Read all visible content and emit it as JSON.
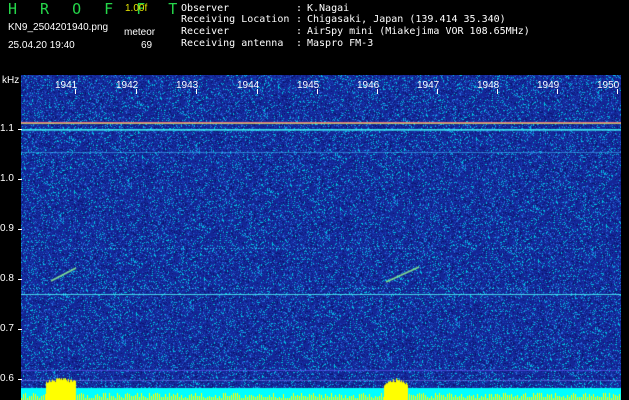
{
  "header": {
    "app_title": "H R O F F T",
    "version": "1.00f",
    "filename": "KN9_2504201940.png",
    "meteor_label": "meteor",
    "datetime": "25.04.20 19:40",
    "meteor_count": "69",
    "info": [
      {
        "key": "Observer",
        "sep": ":",
        "value": "K.Nagai"
      },
      {
        "key": "Receiving Location",
        "sep": ":",
        "value": "Chigasaki, Japan (139.414 35.340)"
      },
      {
        "key": "Receiver",
        "sep": ":",
        "value": "AirSpy mini (Miakejima VOR 108.65MHz)"
      },
      {
        "key": "Receiving antenna",
        "sep": ":",
        "value": "Maspro FM-3"
      }
    ]
  },
  "axis": {
    "unit": "kHz",
    "y_ticks": [
      "1.1",
      "1.0",
      "0.9",
      "0.8",
      "0.7",
      "0.6"
    ],
    "x_ticks": [
      "1941",
      "1942",
      "1943",
      "1944",
      "1945",
      "1946",
      "1947",
      "1948",
      "1949",
      "1950"
    ]
  },
  "colors": {
    "title": "#25d64a",
    "version": "#e6e600",
    "background": "#1b2fa0",
    "level": "#00ffff",
    "burst": "#ffff00"
  }
}
